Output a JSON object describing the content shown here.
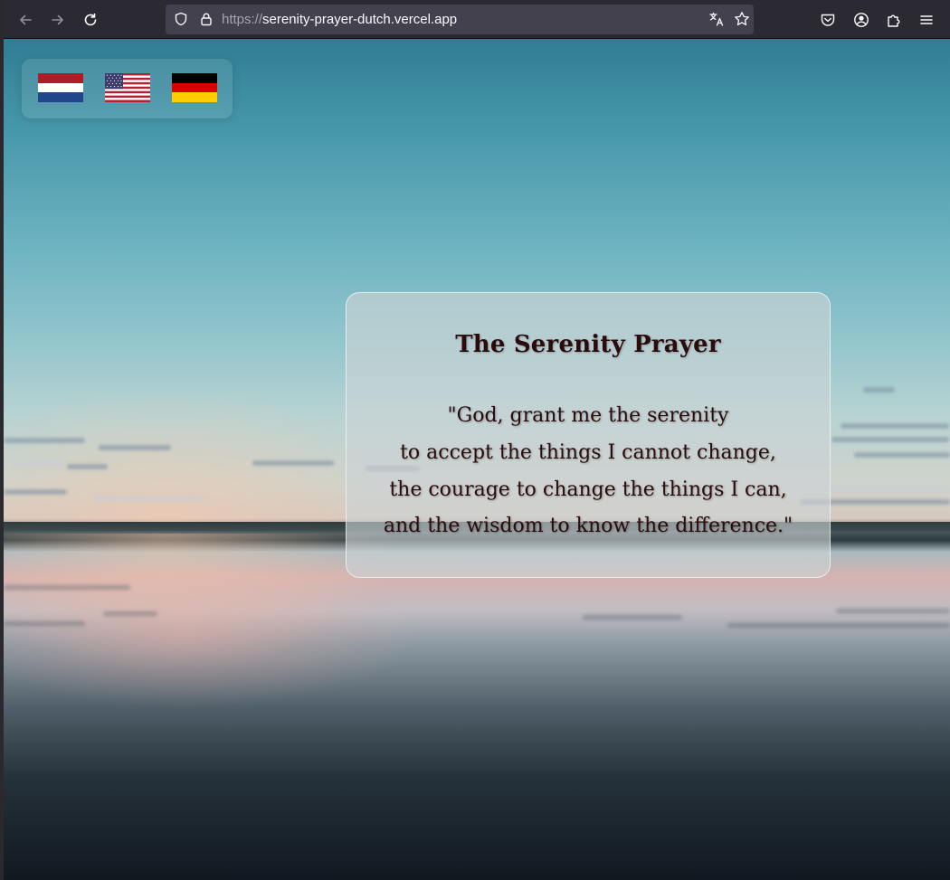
{
  "browser": {
    "url_scheme": "https://",
    "url_host": "serenity-prayer-dutch.vercel.app",
    "icons": {
      "back": "back-arrow-icon",
      "forward": "forward-arrow-icon",
      "reload": "reload-icon",
      "tracking": "shield-icon",
      "lock": "lock-icon",
      "translate": "translate-icon",
      "bookmark": "star-icon",
      "pocket": "pocket-icon",
      "account": "account-icon",
      "extensions": "puzzle-icon",
      "menu": "hamburger-menu-icon"
    }
  },
  "languages": [
    {
      "name": "nl-flag",
      "colors": [
        "#ae1c28",
        "#ffffff",
        "#21468b"
      ]
    },
    {
      "name": "us-flag",
      "colors": [
        "#b22234",
        "#ffffff",
        "#3c3b6e"
      ]
    },
    {
      "name": "de-flag",
      "colors": [
        "#000000",
        "#dd0000",
        "#ffce00"
      ]
    }
  ],
  "prayer": {
    "title": "The Serenity Prayer",
    "lines": [
      "\"God, grant me the serenity",
      "to accept the things I cannot change,",
      "the courage to change the things I can,",
      "and the wisdom to know the difference.\""
    ]
  },
  "colors": {
    "text": "#2b0b0b",
    "card_border": "#f0f8f5"
  }
}
